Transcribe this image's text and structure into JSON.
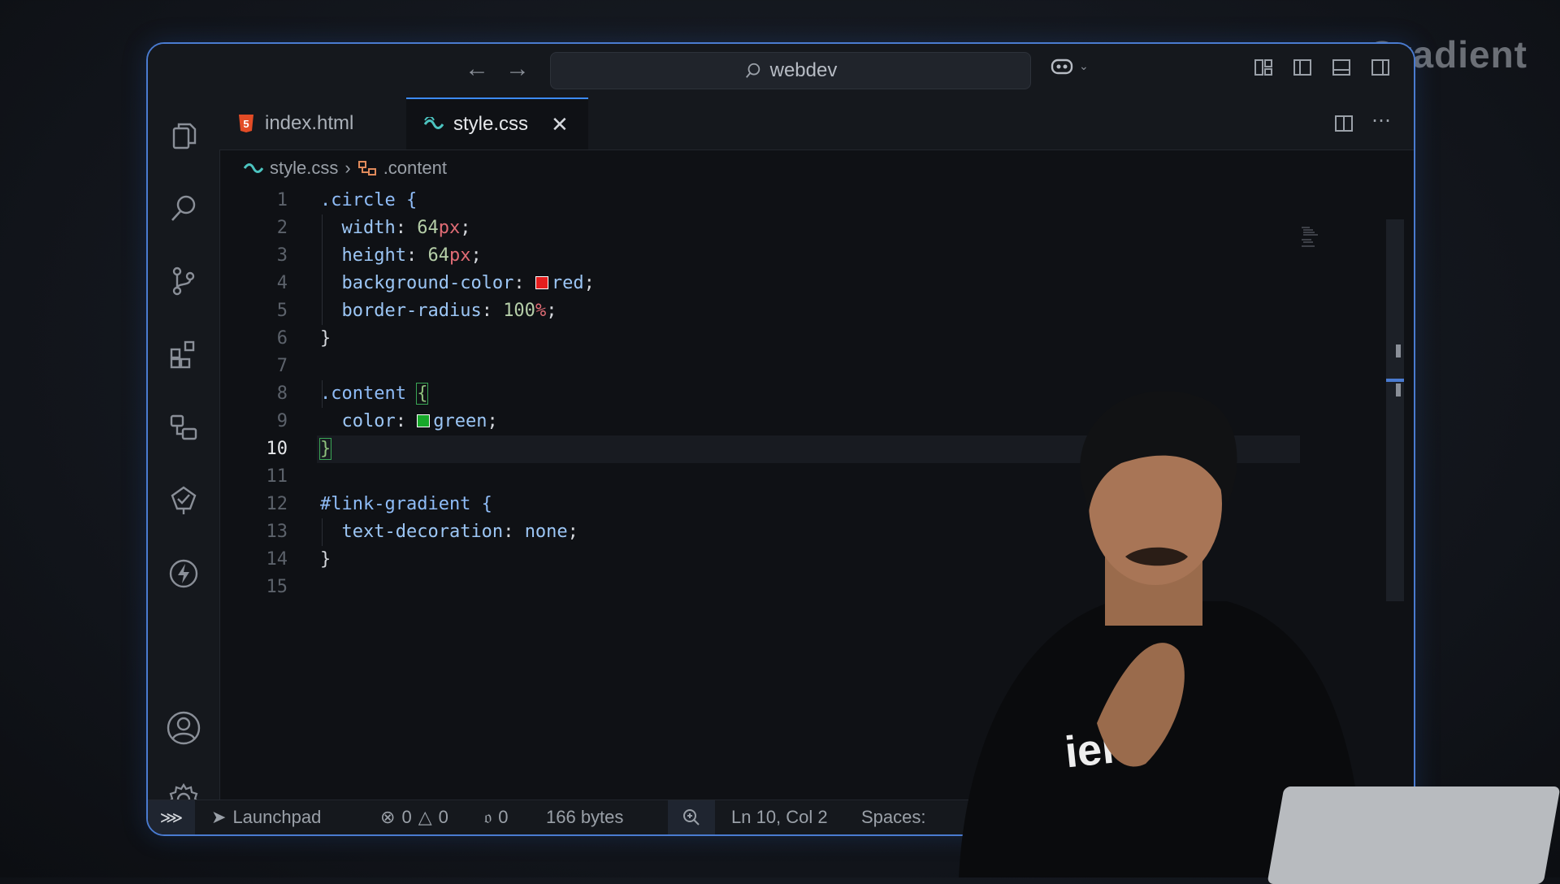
{
  "brand": "Gradient",
  "titlebar": {
    "search": "webdev"
  },
  "tabs": [
    {
      "label": "index.html",
      "active": false
    },
    {
      "label": "style.css",
      "active": true
    }
  ],
  "breadcrumb": {
    "file": "style.css",
    "symbol": ".content"
  },
  "editor": {
    "current_line": "10",
    "lines": [
      "1",
      "2",
      "3",
      "4",
      "5",
      "6",
      "7",
      "8",
      "9",
      "10",
      "11",
      "12",
      "13",
      "14",
      "15"
    ],
    "code": {
      "l1_sel": ".circle",
      "l1_br": " {",
      "l2_prop": "width",
      "l2_num": "64",
      "l2_unit": "px",
      "l3_prop": "height",
      "l3_num": "64",
      "l3_unit": "px",
      "l4_prop": "background-color",
      "l4_val": "red",
      "l5_prop": "border-radius",
      "l5_num": "100",
      "l5_unit": "%",
      "l6": "}",
      "l8_sel": ".content",
      "l8_br": "{",
      "l9_prop": "color",
      "l9_val": "green",
      "l10": "}",
      "l12_sel": "#link-gradient",
      "l12_br": " {",
      "l13_prop": "text-decoration",
      "l13_val": "none",
      "l14": "}"
    },
    "swatch_colors": {
      "red": "#e51e1e",
      "green": "#17a82a"
    }
  },
  "statusbar": {
    "launchpad": "Launchpad",
    "errors": "0",
    "warnings": "0",
    "ports": "0",
    "size": "166 bytes",
    "position": "Ln 10, Col 2",
    "spaces": "Spaces:"
  },
  "shirt_text": "ient",
  "colors": {
    "accent": "#3d8bfd",
    "window_border": "#4a7bd0",
    "background": "#0f1115"
  }
}
